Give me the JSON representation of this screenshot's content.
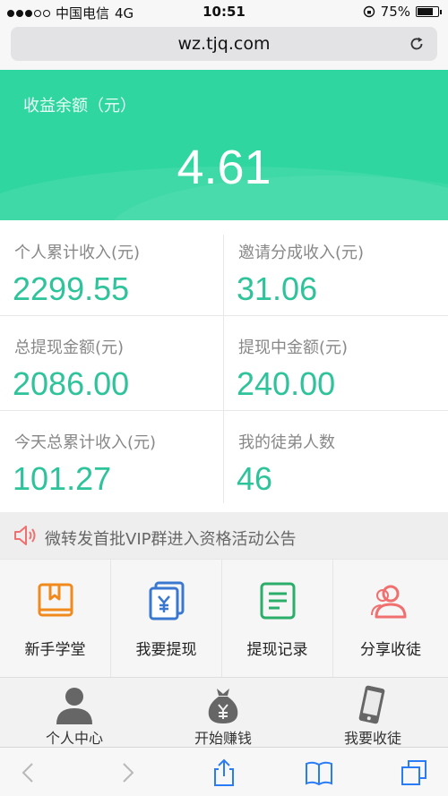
{
  "status_bar": {
    "carrier": "中国电信",
    "network": "4G",
    "time": "10:51",
    "battery": "75%",
    "battery_level": 0.75
  },
  "browser": {
    "url": "wz.tjq.com"
  },
  "balance": {
    "label": "收益余额（元）",
    "amount": "4.61"
  },
  "stats": [
    {
      "label": "个人累计收入(元)",
      "value": "2299.55"
    },
    {
      "label": "邀请分成收入(元)",
      "value": "31.06"
    },
    {
      "label": "总提现金额(元)",
      "value": "2086.00"
    },
    {
      "label": "提现中金额(元)",
      "value": "240.00"
    },
    {
      "label": "今天总累计收入(元)",
      "value": "101.27"
    },
    {
      "label": "我的徒弟人数",
      "value": "46"
    }
  ],
  "notice": {
    "text": "微转发首批VIP群进入资格活动公告"
  },
  "menu": [
    {
      "label": "新手学堂",
      "icon": "book-icon",
      "color": "#f08a1c"
    },
    {
      "label": "我要提现",
      "icon": "yuan-cards-icon",
      "color": "#3a78d0"
    },
    {
      "label": "提现记录",
      "icon": "record-list-icon",
      "color": "#2aae6a"
    },
    {
      "label": "分享收徒",
      "icon": "users-icon",
      "color": "#f07070"
    }
  ],
  "tabbar": [
    {
      "label": "个人中心",
      "icon": "person-icon"
    },
    {
      "label": "开始赚钱",
      "icon": "money-bag-icon"
    },
    {
      "label": "我要收徒",
      "icon": "phone-icon"
    }
  ],
  "colors": {
    "accent": "#2fd6a0",
    "value_green": "#2ec39a"
  }
}
